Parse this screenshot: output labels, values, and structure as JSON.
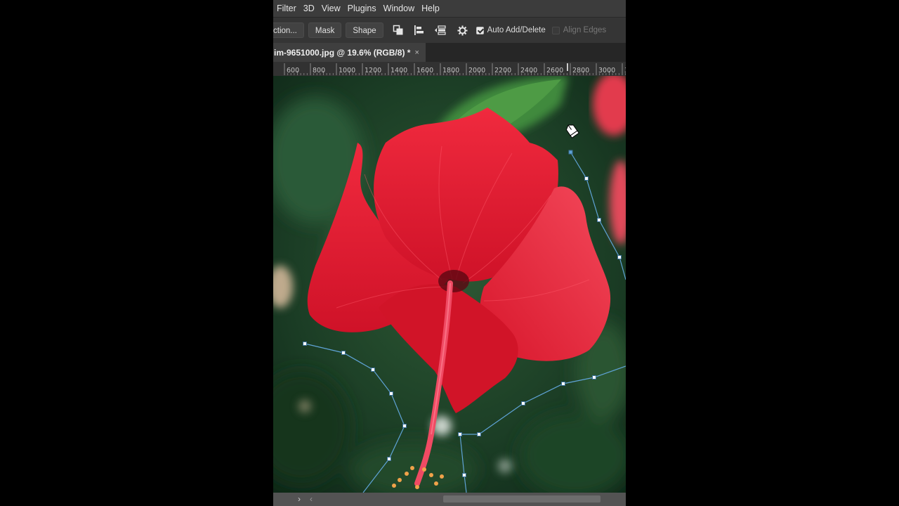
{
  "menu": [
    "Filter",
    "3D",
    "View",
    "Plugins",
    "Window",
    "Help"
  ],
  "options": {
    "selection_label": "ction...",
    "mask_label": "Mask",
    "shape_label": "Shape",
    "auto_add_delete_label": "Auto Add/Delete",
    "auto_add_delete_checked": true,
    "align_edges_label": "Align Edges",
    "align_edges_checked": false,
    "icons": [
      "path-operations-icon",
      "path-alignment-icon",
      "path-arrangement-icon",
      "gear-icon"
    ]
  },
  "document": {
    "tab_title": "im-9651000.jpg @ 19.6% (RGB/8) *",
    "close_symbol": "×"
  },
  "ruler": {
    "ticks": [
      "600",
      "800",
      "1000",
      "1200",
      "1400",
      "1600",
      "1800",
      "2000",
      "2200",
      "2400",
      "2600",
      "2800",
      "3000",
      "3"
    ]
  },
  "canvas": {
    "image_subject": "red hibiscus flower on green foliage",
    "path_color": "#5fa3d6"
  },
  "bottombar": {
    "next_symbol": "›",
    "prev_symbol": "‹"
  },
  "colors": {
    "menubar": "#3c3c3c",
    "optionsbar": "#353535",
    "flower_red": "#e3192f",
    "foliage": "#1f4a2a"
  }
}
